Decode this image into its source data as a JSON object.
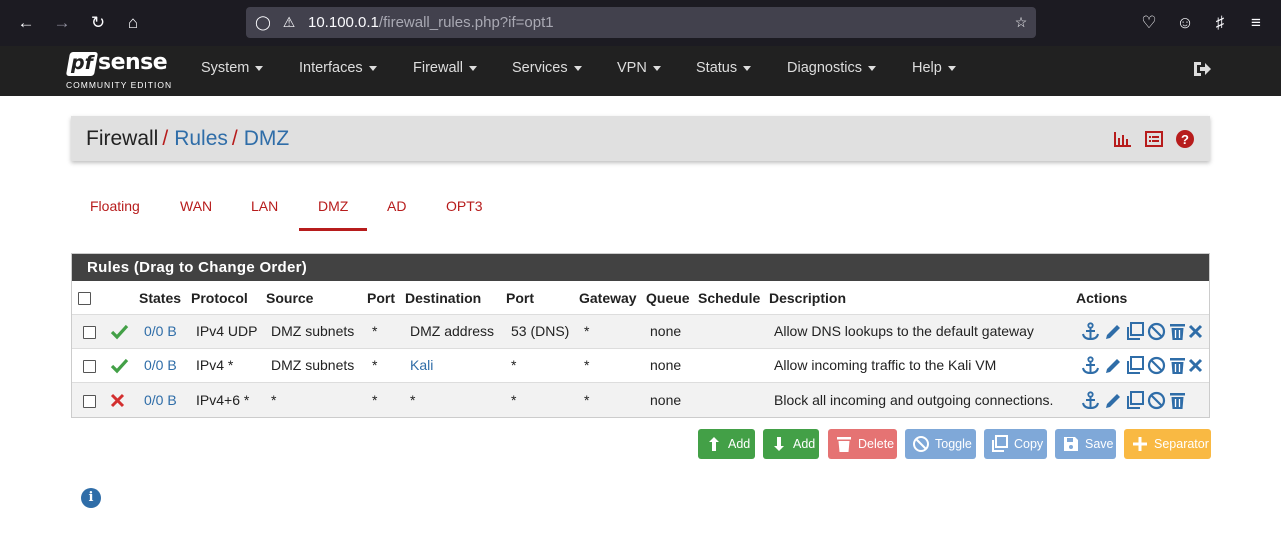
{
  "browser": {
    "url_host": "10.100.0.1",
    "url_path": "/firewall_rules.php?if=opt1"
  },
  "brand": {
    "logo_text_pf": "pf",
    "logo_text_sense": "sense",
    "edition": "COMMUNITY EDITION"
  },
  "nav": {
    "items": [
      "System",
      "Interfaces",
      "Firewall",
      "Services",
      "VPN",
      "Status",
      "Diagnostics",
      "Help"
    ]
  },
  "breadcrumb": {
    "root": "Firewall",
    "sep": "/",
    "level2": "Rules",
    "level3": "DMZ"
  },
  "tabs": {
    "items": [
      "Floating",
      "WAN",
      "LAN",
      "DMZ",
      "AD",
      "OPT3"
    ],
    "active": "DMZ"
  },
  "rules": {
    "title": "Rules (Drag to Change Order)",
    "headers": {
      "states": "States",
      "protocol": "Protocol",
      "source": "Source",
      "port": "Port",
      "destination": "Destination",
      "dport": "Port",
      "gateway": "Gateway",
      "queue": "Queue",
      "schedule": "Schedule",
      "description": "Description",
      "actions": "Actions"
    },
    "rows": [
      {
        "status": "pass",
        "states": "0/0 B",
        "protocol": "IPv4 UDP",
        "source": "DMZ subnets",
        "sport": "*",
        "destination": "DMZ address",
        "dport": "53 (DNS)",
        "gateway": "*",
        "queue": "none",
        "schedule": "",
        "description": "Allow DNS lookups to the default gateway"
      },
      {
        "status": "pass",
        "states": "0/0 B",
        "protocol": "IPv4 *",
        "source": "DMZ subnets",
        "sport": "*",
        "destination": "Kali",
        "dport": "*",
        "gateway": "*",
        "queue": "none",
        "schedule": "",
        "description": "Allow incoming traffic to the Kali VM"
      },
      {
        "status": "block",
        "states": "0/0 B",
        "protocol": "IPv4+6 *",
        "source": "*",
        "sport": "*",
        "destination": "*",
        "dport": "*",
        "gateway": "*",
        "queue": "none",
        "schedule": "",
        "description": "Block all incoming and outgoing connections."
      }
    ]
  },
  "buttons": {
    "add_top": "Add",
    "add_bottom": "Add",
    "delete": "Delete",
    "toggle": "Toggle",
    "copy": "Copy",
    "save": "Save",
    "separator": "Separator"
  },
  "colors": {
    "accent_red": "#b71c1c",
    "link_blue": "#2f6da8",
    "navbar": "#212121",
    "pass_green": "#43a047",
    "block_red": "#d32f2f"
  }
}
